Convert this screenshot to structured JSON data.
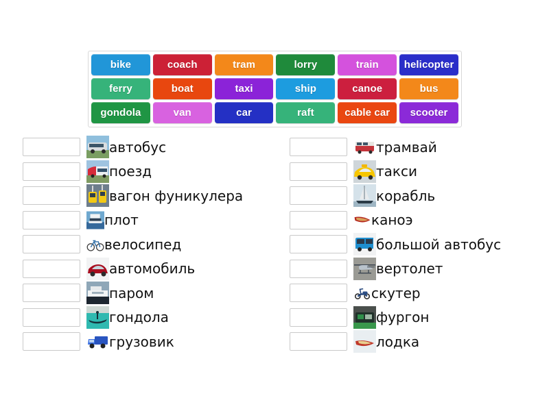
{
  "wordbank": {
    "rows": [
      [
        {
          "label": "bike",
          "color": "#2196d8"
        },
        {
          "label": "coach",
          "color": "#cc2136"
        },
        {
          "label": "tram",
          "color": "#f3881a"
        },
        {
          "label": "lorry",
          "color": "#1f8a3b"
        },
        {
          "label": "train",
          "color": "#d452dd"
        },
        {
          "label": "helicopter",
          "color": "#2a2ec9"
        }
      ],
      [
        {
          "label": "ferry",
          "color": "#36b37a"
        },
        {
          "label": "boat",
          "color": "#e8470f"
        },
        {
          "label": "taxi",
          "color": "#8b23d8"
        },
        {
          "label": "ship",
          "color": "#1d9cdf"
        },
        {
          "label": "canoe",
          "color": "#cc1f3e"
        },
        {
          "label": "bus",
          "color": "#f3881a"
        }
      ],
      [
        {
          "label": "gondola",
          "color": "#1f9544"
        },
        {
          "label": "van",
          "color": "#d862e0"
        },
        {
          "label": "car",
          "color": "#2430c4"
        },
        {
          "label": "raft",
          "color": "#36b37a"
        },
        {
          "label": "cable car",
          "color": "#ea4711"
        },
        {
          "label": "scooter",
          "color": "#8b2ad8"
        }
      ]
    ]
  },
  "columns": {
    "left": [
      {
        "label": "автобус",
        "icon": "coach-photo",
        "blank_value": ""
      },
      {
        "label": "поезд",
        "icon": "train-photo",
        "blank_value": ""
      },
      {
        "label": "вагон фуникулера",
        "icon": "cable-car-photo",
        "blank_value": ""
      },
      {
        "label": "плот",
        "icon": "raft-photo",
        "blank_value": ""
      },
      {
        "label": "велосипед",
        "icon": "bicycle-photo",
        "blank_value": ""
      },
      {
        "label": "автомобиль",
        "icon": "car-photo",
        "blank_value": ""
      },
      {
        "label": "паром",
        "icon": "ferry-photo",
        "blank_value": ""
      },
      {
        "label": "гондола",
        "icon": "gondola-photo",
        "blank_value": ""
      },
      {
        "label": "грузовик",
        "icon": "lorry-photo",
        "blank_value": ""
      }
    ],
    "right": [
      {
        "label": "трамвай",
        "icon": "tram-photo",
        "blank_value": ""
      },
      {
        "label": "такси",
        "icon": "taxi-photo",
        "blank_value": ""
      },
      {
        "label": "корабль",
        "icon": "ship-photo",
        "blank_value": ""
      },
      {
        "label": "каноэ",
        "icon": "canoe-photo",
        "blank_value": ""
      },
      {
        "label": "большой автобус",
        "icon": "bus-photo",
        "blank_value": ""
      },
      {
        "label": "вертолет",
        "icon": "helicopter-photo",
        "blank_value": ""
      },
      {
        "label": "скутер",
        "icon": "scooter-photo",
        "blank_value": ""
      },
      {
        "label": "фургон",
        "icon": "van-photo",
        "blank_value": ""
      },
      {
        "label": "лодка",
        "icon": "boat-photo",
        "blank_value": ""
      }
    ]
  }
}
